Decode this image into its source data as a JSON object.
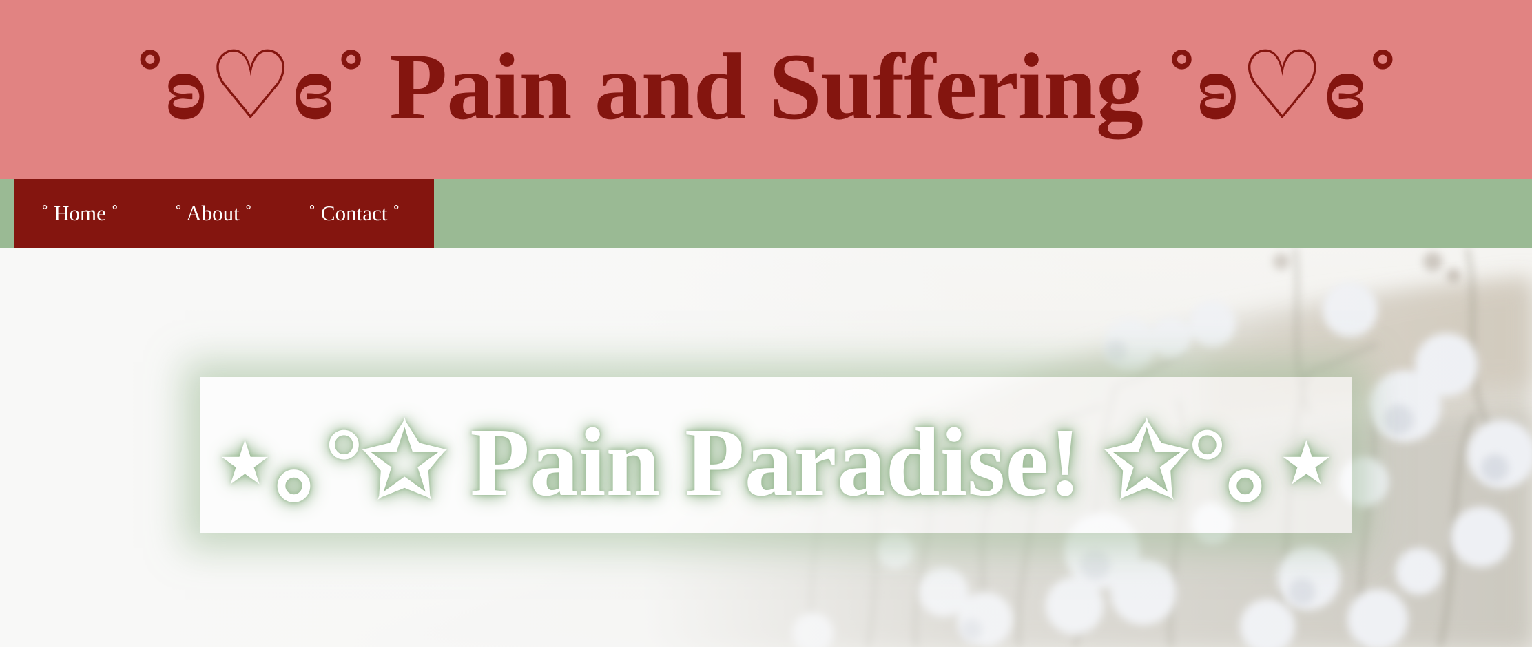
{
  "header": {
    "title": "˚ʚ♡ɞ˚ Pain and Suffering ˚ʚ♡ɞ˚"
  },
  "nav": {
    "items": [
      {
        "label": "˚ Home ˚"
      },
      {
        "label": "˚ About ˚"
      },
      {
        "label": "˚ Contact ˚"
      }
    ]
  },
  "hero": {
    "title": "⋆｡°✩ Pain Paradise! ✩°｡⋆",
    "image": "cotton-field-photo"
  },
  "colors": {
    "header_bg": "#e18382",
    "title_text": "#84150f",
    "nav_bar_bg": "#9aba94",
    "nav_menu_bg": "#84150f",
    "nav_text": "#ffffff",
    "hero_title_text": "#ffffff",
    "hero_glow": "#9aba94"
  }
}
